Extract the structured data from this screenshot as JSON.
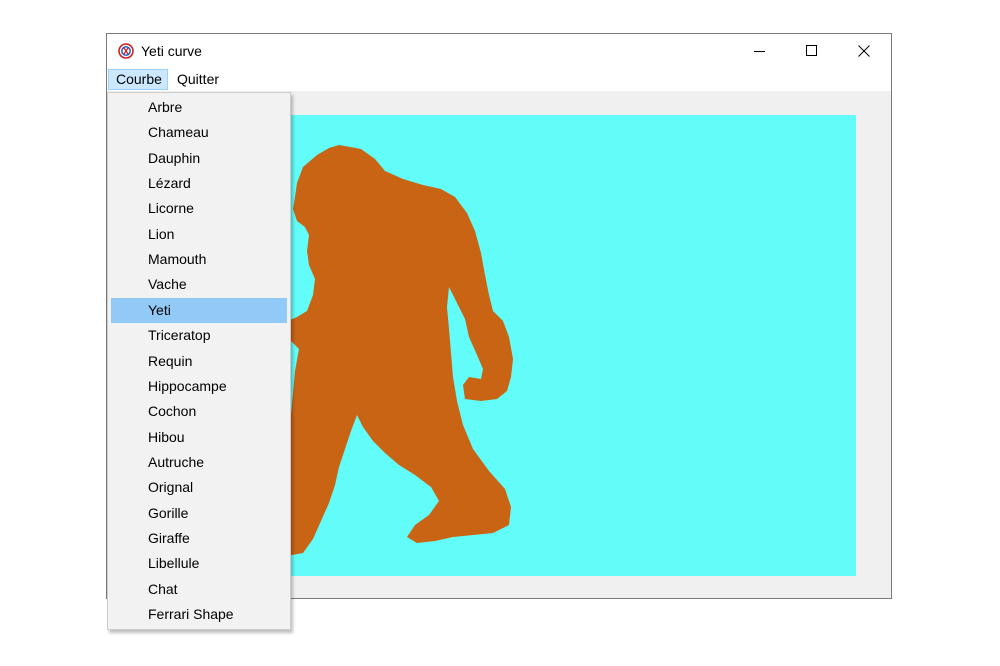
{
  "window": {
    "title": "Yeti curve"
  },
  "menubar": {
    "items": [
      {
        "label": "Courbe"
      },
      {
        "label": "Quitter"
      }
    ]
  },
  "dropdown": {
    "items": [
      {
        "label": "Arbre"
      },
      {
        "label": "Chameau"
      },
      {
        "label": "Dauphin"
      },
      {
        "label": "Lézard"
      },
      {
        "label": "Licorne"
      },
      {
        "label": "Lion"
      },
      {
        "label": "Mamouth"
      },
      {
        "label": "Vache"
      },
      {
        "label": "Yeti"
      },
      {
        "label": "Triceratop"
      },
      {
        "label": "Requin"
      },
      {
        "label": "Hippocampe"
      },
      {
        "label": "Cochon"
      },
      {
        "label": "Hibou"
      },
      {
        "label": "Autruche"
      },
      {
        "label": "Orignal"
      },
      {
        "label": "Gorille"
      },
      {
        "label": "Giraffe"
      },
      {
        "label": "Libellule"
      },
      {
        "label": "Chat"
      },
      {
        "label": "Ferrari Shape"
      }
    ],
    "selected_index": 8
  },
  "canvas": {
    "background_color": "#62fdf8",
    "shape_color": "#c86414",
    "shape_icon": "yeti-silhouette"
  },
  "colors": {
    "menu_highlight": "#cce8ff",
    "menu_highlight_border": "#99d1ff",
    "dropdown_selected": "#91c9f7",
    "window_bg": "#f0f0f0"
  }
}
